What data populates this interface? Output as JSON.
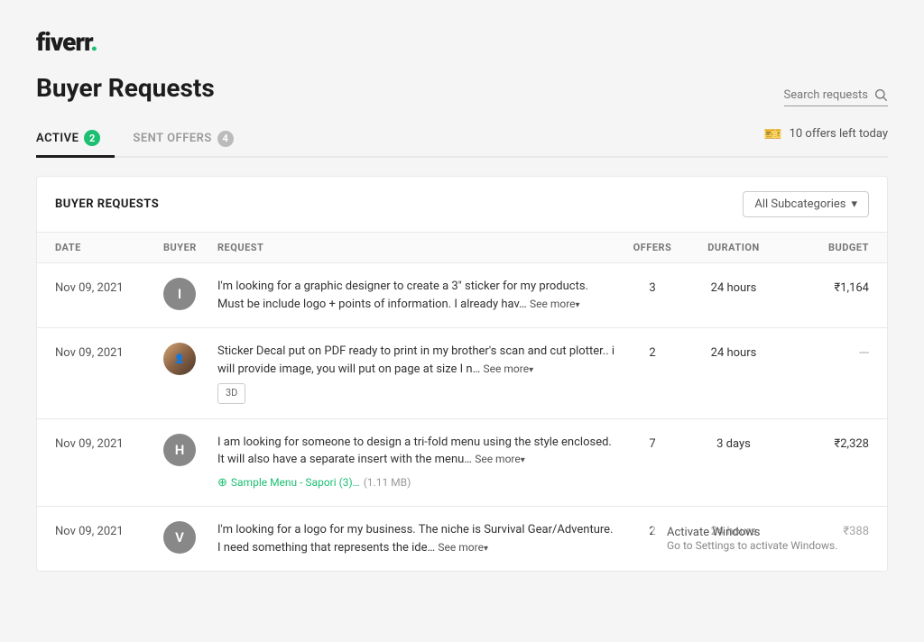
{
  "logo": {
    "text": "fiverr",
    "dot": "."
  },
  "page": {
    "title": "Buyer Requests"
  },
  "search": {
    "placeholder": "Search requests"
  },
  "tabs": [
    {
      "id": "active",
      "label": "ACTIVE",
      "badge": "2",
      "active": true
    },
    {
      "id": "sent-offers",
      "label": "SENT OFFERS",
      "badge": "4",
      "active": false
    }
  ],
  "offers_left": "10 offers left today",
  "card": {
    "title": "BUYER REQUESTS",
    "subcategory_label": "All Subcategories"
  },
  "table": {
    "headers": [
      "DATE",
      "BUYER",
      "REQUEST",
      "OFFERS",
      "DURATION",
      "BUDGET"
    ],
    "rows": [
      {
        "date": "Nov 09, 2021",
        "buyer_initial": "I",
        "buyer_type": "initial",
        "buyer_color": "#888",
        "request": "I'm looking for a graphic designer to create a 3\" sticker for my products. Must be include logo + points of information. I already hav…",
        "see_more": "See more",
        "tag": null,
        "attachment": null,
        "offers": "3",
        "duration": "24 hours",
        "budget": "₹1,164"
      },
      {
        "date": "Nov 09, 2021",
        "buyer_initial": "",
        "buyer_type": "photo",
        "buyer_color": "#c8a882",
        "request": "Sticker Decal put on PDF ready to print in my brother's scan and cut plotter.. i will provide image, you will put on page at size I n…",
        "see_more": "See more",
        "tag": "3D",
        "attachment": null,
        "offers": "2",
        "duration": "24 hours",
        "budget": "---"
      },
      {
        "date": "Nov 09, 2021",
        "buyer_initial": "H",
        "buyer_type": "initial",
        "buyer_color": "#888",
        "request": "I am looking for someone to design a tri-fold menu using the style enclosed. It will also have a separate insert with the menu…",
        "see_more": "See more",
        "tag": null,
        "attachment": "Sample Menu - Sapori (3)…  (1.11 MB)",
        "offers": "7",
        "duration": "3 days",
        "budget": "₹2,328"
      },
      {
        "date": "Nov 09, 2021",
        "buyer_initial": "V",
        "buyer_type": "initial",
        "buyer_color": "#888",
        "request": "I'm looking for a logo for my business. The niche is Survival Gear/Adventure. I need something that represents the ide…",
        "see_more": "See more",
        "tag": null,
        "attachment": null,
        "offers": "2",
        "duration": "24 hours",
        "budget": "₹388"
      }
    ]
  },
  "windows_activate": {
    "title": "Activate Windows",
    "subtitle": "Go to Settings to activate Windows."
  }
}
